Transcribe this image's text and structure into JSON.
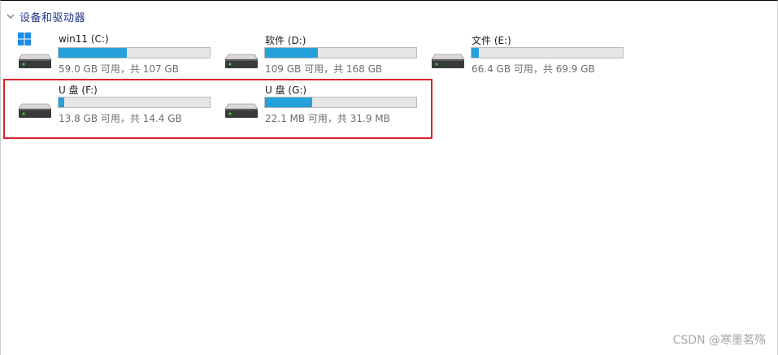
{
  "section": {
    "title": "设备和驱动器"
  },
  "drives": [
    {
      "name": "win11 (C:)",
      "free_text": "59.0 GB 可用，共 107 GB",
      "used_fraction": 0.45,
      "icon": "system-drive-icon"
    },
    {
      "name": "软件 (D:)",
      "free_text": "109 GB 可用，共 168 GB",
      "used_fraction": 0.35,
      "icon": "hard-drive-icon"
    },
    {
      "name": "文件 (E:)",
      "free_text": "66.4 GB 可用，共 69.9 GB",
      "used_fraction": 0.05,
      "icon": "hard-drive-icon"
    },
    {
      "name": "U 盘 (F:)",
      "free_text": "13.8 GB 可用，共 14.4 GB",
      "used_fraction": 0.04,
      "icon": "usb-drive-icon"
    },
    {
      "name": "U 盘 (G:)",
      "free_text": "22.1 MB 可用，共 31.9 MB",
      "used_fraction": 0.31,
      "icon": "usb-drive-icon"
    }
  ],
  "watermark": "CSDN @寒墨茗殇",
  "colors": {
    "bar_fill": "#26a0da",
    "bar_track": "#e6e6e6",
    "highlight": "#d9232d",
    "section_title": "#1e3287"
  }
}
